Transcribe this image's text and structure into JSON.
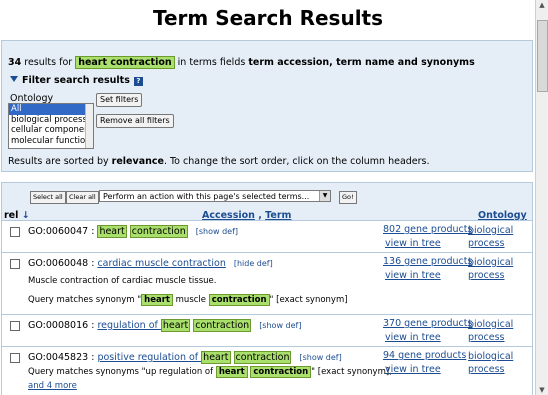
{
  "page_title": "Term Search Results",
  "summary": {
    "count": "34",
    "text1": " results for ",
    "query": "heart contraction",
    "text2": " in terms fields ",
    "fields": "term accession, term name and synonyms"
  },
  "filter": {
    "header": "Filter search results",
    "help_icon": "?",
    "ontology_label": "Ontology",
    "options": [
      "All",
      "biological process",
      "cellular component",
      "molecular function"
    ],
    "selected": "All",
    "set_filters": "Set filters",
    "remove_all": "Remove all filters"
  },
  "sorting": {
    "prefix": "Results are sorted by ",
    "key": "relevance",
    "suffix": ". To change the sort order, click on the column headers."
  },
  "toolbar": {
    "select_all": "Select all",
    "clear_all": "Clear all",
    "action_select": "Perform an action with this page's selected terms...",
    "go": "Go!"
  },
  "columns": {
    "rel": "rel",
    "rel_arrow": "↓",
    "accession": "Accession",
    "comma": " , ",
    "term": "Term",
    "ontology": "Ontology"
  },
  "rows": [
    {
      "accession": "GO:0060047",
      "sep": " : ",
      "term_prefix": "",
      "term_h1": "heart",
      "term_h2": "contraction",
      "def_toggle": "[show def]",
      "gene_products": "802 gene products",
      "view_tree": "view in tree",
      "ontology1": "biological",
      "ontology2": "process"
    },
    {
      "accession": "GO:0060048",
      "sep": " : ",
      "term": "cardiac muscle contraction",
      "def_toggle": "[hide def]",
      "definition": "Muscle contraction of cardiac muscle tissue.",
      "match_prefix": "Query matches synonym \"",
      "match_h1": "heart",
      "match_mid": " muscle ",
      "match_h2": "contraction",
      "match_suffix": "\" [exact synonym]",
      "gene_products": "136 gene products",
      "view_tree": "view in tree",
      "ontology1": "biological",
      "ontology2": "process"
    },
    {
      "accession": "GO:0008016",
      "sep": " : ",
      "term_prefix": "regulation of ",
      "term_h1": "heart",
      "term_h2": "contraction",
      "def_toggle": "[show def]",
      "gene_products": "370 gene products",
      "view_tree": "view in tree",
      "ontology1": "biological",
      "ontology2": "process"
    },
    {
      "accession": "GO:0045823",
      "sep": " : ",
      "term_prefix": "positive regulation of ",
      "term_h1": "heart",
      "term_h2": "contraction",
      "def_toggle": "[show def]",
      "match_prefix": "Query matches synonyms  \"up regulation of ",
      "match_h1": "heart",
      "match_h2": "contraction",
      "match_suffix": "\" [exact synonym],",
      "more": "and 4 more",
      "gene_products": "94 gene products",
      "view_tree": "view in tree",
      "ontology1": "biological",
      "ontology2": "process"
    }
  ]
}
